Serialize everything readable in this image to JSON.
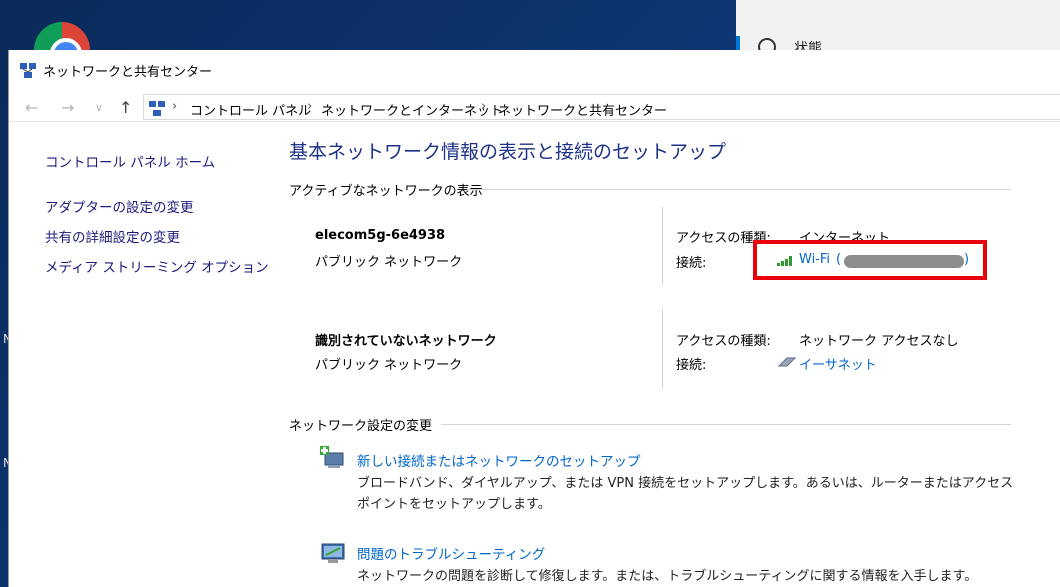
{
  "desktop": {
    "settings_label": "状態",
    "side_letters": [
      "N",
      "N"
    ]
  },
  "window": {
    "title": "ネットワークと共有センター"
  },
  "addressbar": {
    "back": "←",
    "forward": "→",
    "recent": "∨",
    "up": "↑",
    "breadcrumbs": [
      "コントロール パネル",
      "ネットワークとインターネット",
      "ネットワークと共有センター"
    ]
  },
  "sidebar": {
    "home": "コントロール パネル ホーム",
    "links": [
      "アダプターの設定の変更",
      "共有の詳細設定の変更",
      "メディア ストリーミング オプション"
    ]
  },
  "main": {
    "title": "基本ネットワーク情報の表示と接続のセットアップ",
    "active_heading": "アクティブなネットワークの表示",
    "networks": [
      {
        "name": "elecom5g-6e4938",
        "type": "パブリック ネットワーク",
        "access_label": "アクセスの種類:",
        "access_value": "インターネット",
        "conn_label": "接続:",
        "conn_value": "Wi-Fi"
      },
      {
        "name": "識別されていないネットワーク",
        "type": "パブリック ネットワーク",
        "access_label": "アクセスの種類:",
        "access_value": "ネットワーク アクセスなし",
        "conn_label": "接続:",
        "conn_value": "イーサネット"
      }
    ],
    "change_heading": "ネットワーク設定の変更",
    "tasks": [
      {
        "link": "新しい接続またはネットワークのセットアップ",
        "desc": "ブロードバンド、ダイヤルアップ、または VPN 接続をセットアップします。あるいは、ルーターまたはアクセス ポイントをセットアップします。"
      },
      {
        "link": "問題のトラブルシューティング",
        "desc": "ネットワークの問題を診断して修復します。または、トラブルシューティングに関する情報を入手します。"
      }
    ]
  },
  "colors": {
    "link": "#0066cc",
    "title": "#1e3287",
    "highlight": "#e8000b"
  }
}
